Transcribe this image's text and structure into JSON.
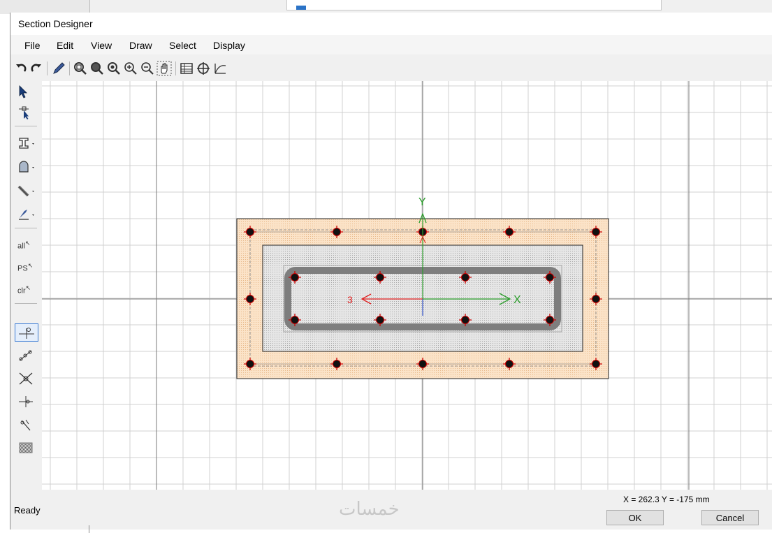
{
  "window": {
    "title": "Section Designer"
  },
  "menu": [
    "File",
    "Edit",
    "View",
    "Draw",
    "Select",
    "Display"
  ],
  "toolbar_icons": [
    "undo-icon",
    "redo-icon",
    "pencil-icon",
    "zoom-window-icon",
    "zoom-in-icon",
    "zoom-out-icon",
    "zoom-step-in-icon",
    "zoom-step-out-icon",
    "pan-icon",
    "table-icon",
    "crosshair-icon",
    "curve-icon"
  ],
  "left_tools": {
    "all_label": "all",
    "ps_label": "PS",
    "clr_label": "clr"
  },
  "canvas": {
    "axis_y_label": "Y",
    "axis_x_label": "X",
    "axis_3_label": "3",
    "colors": {
      "outer_fill": "#fbe3c8",
      "inner_fill": "#e2e2e2",
      "rebar": "#cc0000",
      "bar": "#808080",
      "axis_x": "#2a9d2a",
      "axis_3": "#e02020",
      "grid": "#d0d0d0",
      "grid_major": "#7a7a7a"
    }
  },
  "status": {
    "text": "Ready",
    "coordinates": "X = 262.3   Y = -175 mm",
    "ok_label": "OK",
    "cancel_label": "Cancel"
  },
  "watermark": "خمسات"
}
